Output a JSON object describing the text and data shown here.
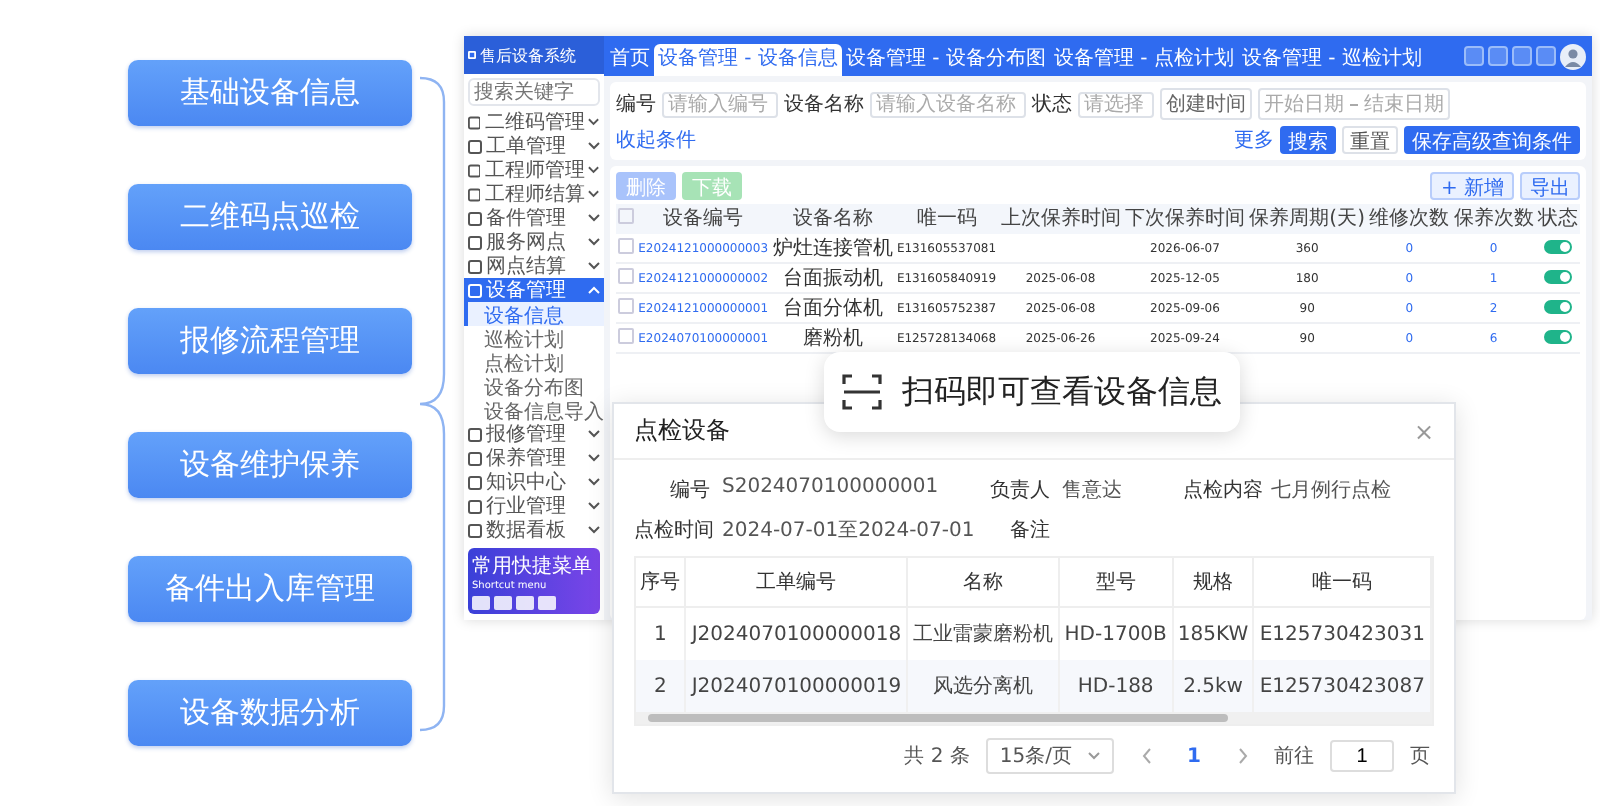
{
  "features": [
    {
      "label": "基础设备信息"
    },
    {
      "label": "二维码点巡检"
    },
    {
      "label": "报修流程管理"
    },
    {
      "label": "设备维护保养"
    },
    {
      "label": "备件出入库管理"
    },
    {
      "label": "设备数据分析"
    }
  ],
  "app": {
    "logo": "售后设备系统",
    "sidebar": {
      "search_placeholder": "搜索关键字",
      "items": [
        {
          "label": "二维码管理",
          "selected": false,
          "expanded": false
        },
        {
          "label": "工单管理",
          "selected": false,
          "expanded": false
        },
        {
          "label": "工程师管理",
          "selected": false,
          "expanded": false
        },
        {
          "label": "工程师结算",
          "selected": false,
          "expanded": false
        },
        {
          "label": "备件管理",
          "selected": false,
          "expanded": false
        },
        {
          "label": "服务网点",
          "selected": false,
          "expanded": false
        },
        {
          "label": "网点结算",
          "selected": false,
          "expanded": false
        },
        {
          "label": "设备管理",
          "selected": true,
          "expanded": true,
          "children": [
            {
              "label": "设备信息",
              "selected": true
            },
            {
              "label": "巡检计划",
              "selected": false
            },
            {
              "label": "点检计划",
              "selected": false
            },
            {
              "label": "设备分布图",
              "selected": false
            },
            {
              "label": "设备信息导入",
              "selected": false
            }
          ]
        },
        {
          "label": "报修管理",
          "selected": false,
          "expanded": false
        },
        {
          "label": "保养管理",
          "selected": false,
          "expanded": false
        },
        {
          "label": "知识中心",
          "selected": false,
          "expanded": false
        },
        {
          "label": "行业管理",
          "selected": false,
          "expanded": false
        },
        {
          "label": "数据看板",
          "selected": false,
          "expanded": false
        }
      ],
      "shortcut": {
        "title": "常用快捷菜单",
        "subtitle": "Shortcut menu"
      }
    },
    "tabs": [
      {
        "label": "首页",
        "selected": false
      },
      {
        "label": "设备管理 - 设备信息",
        "selected": true
      },
      {
        "label": "设备管理 - 设备分布图",
        "selected": false
      },
      {
        "label": "设备管理 - 点检计划",
        "selected": false
      },
      {
        "label": "设备管理 - 巡检计划",
        "selected": false
      }
    ],
    "filters": [
      {
        "label": "编号",
        "placeholder": "请输入编号"
      },
      {
        "label": "设备名称",
        "placeholder": "请输入设备名称"
      },
      {
        "label": "状态",
        "placeholder": "请选择"
      }
    ],
    "date_filter": {
      "label": "创建时间",
      "start": "开始日期",
      "end": "结束日期"
    },
    "more": "更多",
    "search_button": "搜索",
    "reset_button": "重置",
    "collapse_link": "收起条件",
    "save_query_button": "保存高级查询条件",
    "left_actions": [
      {
        "label": "删除",
        "kind": "primary"
      },
      {
        "label": "下载",
        "kind": "success"
      }
    ],
    "right_actions": [
      {
        "label": "+ 新增"
      },
      {
        "label": "导出"
      }
    ],
    "table": {
      "all_checked": false,
      "columns": [
        "设备编号",
        "设备名称",
        "唯一码",
        "上次保养时间",
        "下次保养时间",
        "保养周期(天)",
        "维修次数",
        "保养次数",
        "状态"
      ],
      "rows": [
        {
          "checked": false,
          "on": true,
          "cells": [
            "E2024121000000003",
            "炉灶连接管机",
            "E131605537081",
            "",
            "2026-06-07",
            "360",
            "0",
            "0"
          ]
        },
        {
          "checked": false,
          "on": true,
          "cells": [
            "E2024121000000002",
            "台面振动机",
            "E131605840919",
            "2025-06-08",
            "2025-12-05",
            "180",
            "0",
            "1"
          ]
        },
        {
          "checked": false,
          "on": true,
          "cells": [
            "E2024121000000001",
            "台面分体机",
            "E131605752387",
            "2025-06-08",
            "2025-09-06",
            "90",
            "0",
            "2"
          ]
        },
        {
          "checked": false,
          "on": true,
          "cells": [
            "E2024070100000001",
            "磨粉机",
            "E125728134068",
            "2025-06-26",
            "2025-09-24",
            "90",
            "0",
            "6"
          ]
        }
      ]
    }
  },
  "callout": {
    "text": "扫码即可查看设备信息"
  },
  "dialog": {
    "title": "点检设备",
    "close": "×",
    "fields": [
      {
        "label": "编号",
        "value": "S2024070100000001"
      },
      {
        "label": "负责人",
        "value": "售意达"
      },
      {
        "label": "点检内容",
        "value": "七月例行点检"
      },
      {
        "label": "点检时间",
        "value": "2024-07-01至2024-07-01"
      },
      {
        "label": "备注"
      }
    ],
    "columns": [
      "序号",
      "工单编号",
      "名称",
      "型号",
      "规格",
      "唯一码"
    ],
    "rows": [
      [
        "1",
        "J2024070100000018",
        "工业雷蒙磨粉机",
        "HD-1700B",
        "185KW",
        "E125730423031"
      ],
      [
        "2",
        "J2024070100000019",
        "风选分离机",
        "HD-188",
        "2.5kw",
        "E125730423087"
      ]
    ],
    "pagination": {
      "total": "共 2 条",
      "page_size": "15条/页",
      "pages": [
        {
          "label": "1",
          "selected": true
        }
      ],
      "goto_label": "前往",
      "goto_value": "1",
      "goto_unit": "页"
    }
  }
}
